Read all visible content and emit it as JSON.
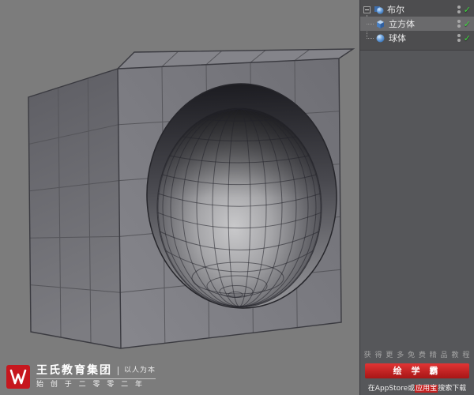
{
  "viewport": {
    "description": "boolean-cube-with-sphere-cutout"
  },
  "scene_tree": {
    "check_glyph": "✓",
    "items": [
      {
        "label": "布尔",
        "type": "boolean",
        "enabled": true
      },
      {
        "label": "立方体",
        "type": "cube",
        "enabled": true,
        "selected": true
      },
      {
        "label": "球体",
        "type": "sphere",
        "enabled": true
      }
    ]
  },
  "brand": {
    "company": "王氏教育集团",
    "slogan": "以人为本",
    "since": "始 创 于 二 零 零 二 年"
  },
  "promo": {
    "tagline": "获 得 更 多 免 费 精 品 教 程",
    "app_name": "绘 学 霸",
    "download_prefix": "在AppStore或",
    "download_highlight": "应用宝",
    "download_suffix": "搜索下载"
  },
  "colors": {
    "viewport_bg": "#7c7c7c",
    "panel_bg": "#56575a",
    "tree_bg": "#4d4d4f",
    "accent_red": "#c6171e",
    "check_green": "#3ddc3d",
    "icon_blue": "#4a7fc1"
  }
}
